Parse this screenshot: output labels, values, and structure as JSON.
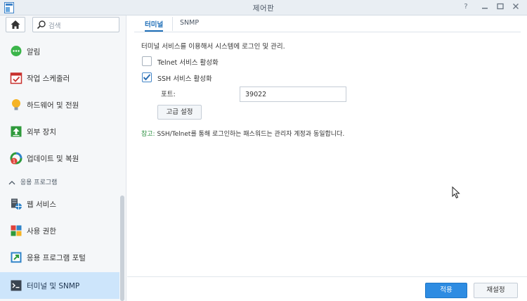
{
  "window": {
    "title": "제어판"
  },
  "sidebar": {
    "search_placeholder": "검색",
    "items": [
      {
        "label": "알림",
        "icon": "chat-bubble-icon"
      },
      {
        "label": "작업 스케줄러",
        "icon": "calendar-check-icon"
      },
      {
        "label": "하드웨어 및 전원",
        "icon": "lightbulb-icon"
      },
      {
        "label": "외부 장치",
        "icon": "upload-device-icon"
      },
      {
        "label": "업데이트 및 복원",
        "icon": "update-restore-icon",
        "badge": "1"
      }
    ],
    "section_header": "응용 프로그램",
    "app_items": [
      {
        "label": "웹 서비스",
        "icon": "web-service-icon"
      },
      {
        "label": "사용 권한",
        "icon": "privileges-icon"
      },
      {
        "label": "응용 프로그램 포털",
        "icon": "portal-icon"
      },
      {
        "label": "터미널 및 SNMP",
        "icon": "terminal-icon",
        "active": true
      }
    ]
  },
  "main": {
    "tabs": [
      {
        "label": "터미널",
        "active": true
      },
      {
        "label": "SNMP",
        "active": false
      }
    ],
    "description": "터미널 서비스를 이용해서 시스템에 로그인 및 관리.",
    "telnet": {
      "label": "Telnet 서비스 활성화",
      "checked": false
    },
    "ssh": {
      "label": "SSH 서비스 활성화",
      "checked": true
    },
    "port": {
      "label": "포트:",
      "value": "39022"
    },
    "advanced_button": "고급 설정",
    "note_prefix": "참고:",
    "note_text": " SSH/Telnet를 통해 로그인하는 패스워드는 관리자 계정과 동일합니다.",
    "apply_button": "적용",
    "reset_button": "재설정"
  },
  "colors": {
    "accent": "#2e8ce2",
    "active_item_bg": "#cde5fb",
    "note_green": "#2a8f3f"
  }
}
